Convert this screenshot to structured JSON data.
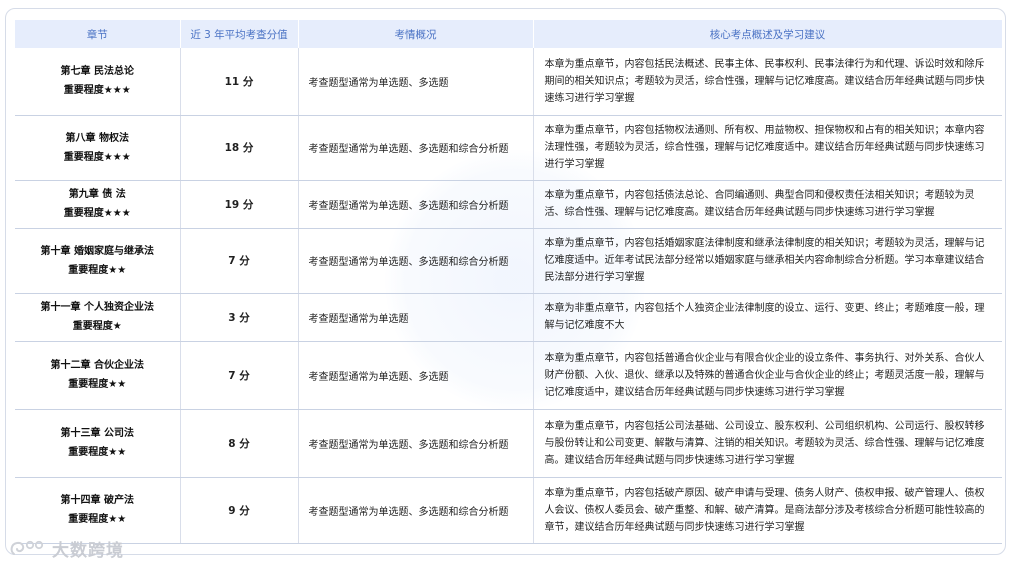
{
  "table": {
    "headers": [
      "章节",
      "近 3 年平均考查分值",
      "考情概况",
      "核心考点概述及学习建议"
    ],
    "rows": [
      {
        "chapter": "第七章 民法总论",
        "importance": "重要程度★★★",
        "score": "11 分",
        "exam": "考查题型通常为单选题、多选题",
        "desc": "本章为重点章节，内容包括民法概述、民事主体、民事权利、民事法律行为和代理、诉讼时效和除斥期间的相关知识点；考题较为灵活，综合性强，理解与记忆难度高。建议结合历年经典试题与同步快速练习进行学习掌握"
      },
      {
        "chapter": "第八章 物权法",
        "importance": "重要程度★★★",
        "score": "18 分",
        "exam": "考查题型通常为单选题、多选题和综合分析题",
        "desc": "本章为重点章节，内容包括物权法通则、所有权、用益物权、担保物权和占有的相关知识；本章内容法理性强，考题较为灵活，综合性强，理解与记忆难度适中。建议结合历年经典试题与同步快速练习进行学习掌握"
      },
      {
        "chapter": "第九章 债 法",
        "importance": "重要程度★★★",
        "score": "19 分",
        "exam": "考查题型通常为单选题、多选题和综合分析题",
        "desc": "本章为重点章节，内容包括债法总论、合同编通则、典型合同和侵权责任法相关知识；考题较为灵活、综合性强、理解与记忆难度高。建议结合历年经典试题与同步快速练习进行学习掌握"
      },
      {
        "chapter": "第十章 婚姻家庭与继承法",
        "importance": "重要程度★★",
        "score": "7 分",
        "exam": "考查题型通常为单选题、多选题和综合分析题",
        "desc": "本章为重点章节，内容包括婚姻家庭法律制度和继承法律制度的相关知识；考题较为灵活，理解与记忆难度适中。近年考试民法部分经常以婚姻家庭与继承相关内容命制综合分析题。学习本章建议结合民法部分进行学习掌握"
      },
      {
        "chapter": "第十一章 个人独资企业法",
        "importance": "重要程度★",
        "score": "3 分",
        "exam": "考查题型通常为单选题",
        "desc": "本章为非重点章节，内容包括个人独资企业法律制度的设立、运行、变更、终止；考题难度一般，理解与记忆难度不大"
      },
      {
        "chapter": "第十二章 合伙企业法",
        "importance": "重要程度★★",
        "score": "7 分",
        "exam": "考查题型通常为单选题、多选题",
        "desc": "本章为重点章节，内容包括普通合伙企业与有限合伙企业的设立条件、事务执行、对外关系、合伙人财产份额、入伙、退伙、继承以及特殊的普通合伙企业与合伙企业的终止；考题灵活度一般，理解与记忆难度适中，建议结合历年经典试题与同步快速练习进行学习掌握"
      },
      {
        "chapter": "第十三章 公司法",
        "importance": "重要程度★★",
        "score": "8 分",
        "exam": "考查题型通常为单选题、多选题和综合分析题",
        "desc": "本章为重点章节，内容包括公司法基础、公司设立、股东权利、公司组织机构、公司运行、股权转移与股份转让和公司变更、解散与清算、注销的相关知识。考题较为灵活、综合性强、理解与记忆难度高。建议结合历年经典试题与同步快速练习进行学习掌握"
      },
      {
        "chapter": "第十四章 破产法",
        "importance": "重要程度★★",
        "score": "9 分",
        "exam": "考查题型通常为单选题、多选题和综合分析题",
        "desc": "本章为重点章节，内容包括破产原因、破产申请与受理、债务人财产、债权申报、破产管理人、债权人会议、债权人委员会、破产重整、和解、破产清算。是商法部分涉及考核综合分析题可能性较高的章节，建议结合历年经典试题与同步快速练习进行学习掌握"
      }
    ]
  },
  "brand": {
    "logo_text": "大数跨境",
    "logo_icon": "brand-swirl-icon"
  },
  "colors": {
    "header_bg": "#e6edfc",
    "header_text": "#4a72c4",
    "row_border": "#c9d2e3"
  }
}
